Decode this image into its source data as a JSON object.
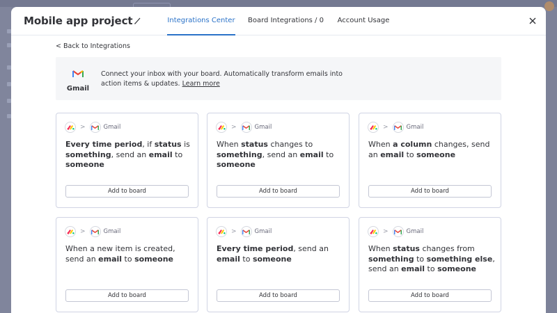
{
  "modal": {
    "title": "Mobile app project",
    "tabs": [
      {
        "label": "Integrations Center",
        "active": true
      },
      {
        "label": "Board Integrations / 0",
        "active": false
      },
      {
        "label": "Account Usage",
        "active": false
      }
    ]
  },
  "back_link": "< Back to Integrations",
  "banner": {
    "service_name": "Gmail",
    "description": "Connect your inbox with your board. Automatically transform emails into action items & updates.",
    "learn_more": "Learn more"
  },
  "colors": {
    "accent": "#2a72c8",
    "border": "#d0d4e4",
    "banner_bg": "#f5f6f8"
  },
  "cards": [
    {
      "service_name": "Gmail",
      "recipe": [
        [
          "Every time period",
          true
        ],
        [
          ", if ",
          false
        ],
        [
          "status",
          true
        ],
        [
          " is ",
          false
        ],
        [
          "something",
          true
        ],
        [
          ", send an ",
          false
        ],
        [
          "email",
          true
        ],
        [
          " to ",
          false
        ],
        [
          "someone",
          true
        ]
      ],
      "button_label": "Add to board"
    },
    {
      "service_name": "Gmail",
      "recipe": [
        [
          "When ",
          false
        ],
        [
          "status",
          true
        ],
        [
          " changes to ",
          false
        ],
        [
          "something",
          true
        ],
        [
          ", send an ",
          false
        ],
        [
          "email",
          true
        ],
        [
          " to ",
          false
        ],
        [
          "someone",
          true
        ]
      ],
      "button_label": "Add to board"
    },
    {
      "service_name": "Gmail",
      "recipe": [
        [
          "When ",
          false
        ],
        [
          "a column",
          true
        ],
        [
          " changes, send an ",
          false
        ],
        [
          "email",
          true
        ],
        [
          " to ",
          false
        ],
        [
          "someone",
          true
        ]
      ],
      "button_label": "Add to board"
    },
    {
      "service_name": "Gmail",
      "recipe": [
        [
          "When a new item is created, send an ",
          false
        ],
        [
          "email",
          true
        ],
        [
          " to ",
          false
        ],
        [
          "someone",
          true
        ]
      ],
      "button_label": "Add to board"
    },
    {
      "service_name": "Gmail",
      "recipe": [
        [
          "Every time period",
          true
        ],
        [
          ", send an ",
          false
        ],
        [
          "email",
          true
        ],
        [
          " to ",
          false
        ],
        [
          "someone",
          true
        ]
      ],
      "button_label": "Add to board"
    },
    {
      "service_name": "Gmail",
      "recipe": [
        [
          "When ",
          false
        ],
        [
          "status",
          true
        ],
        [
          " changes from ",
          false
        ],
        [
          "something",
          true
        ],
        [
          " to ",
          false
        ],
        [
          "something else",
          true
        ],
        [
          ", send an ",
          false
        ],
        [
          "email",
          true
        ],
        [
          " to ",
          false
        ],
        [
          "someone",
          true
        ]
      ],
      "button_label": "Add to board"
    }
  ]
}
